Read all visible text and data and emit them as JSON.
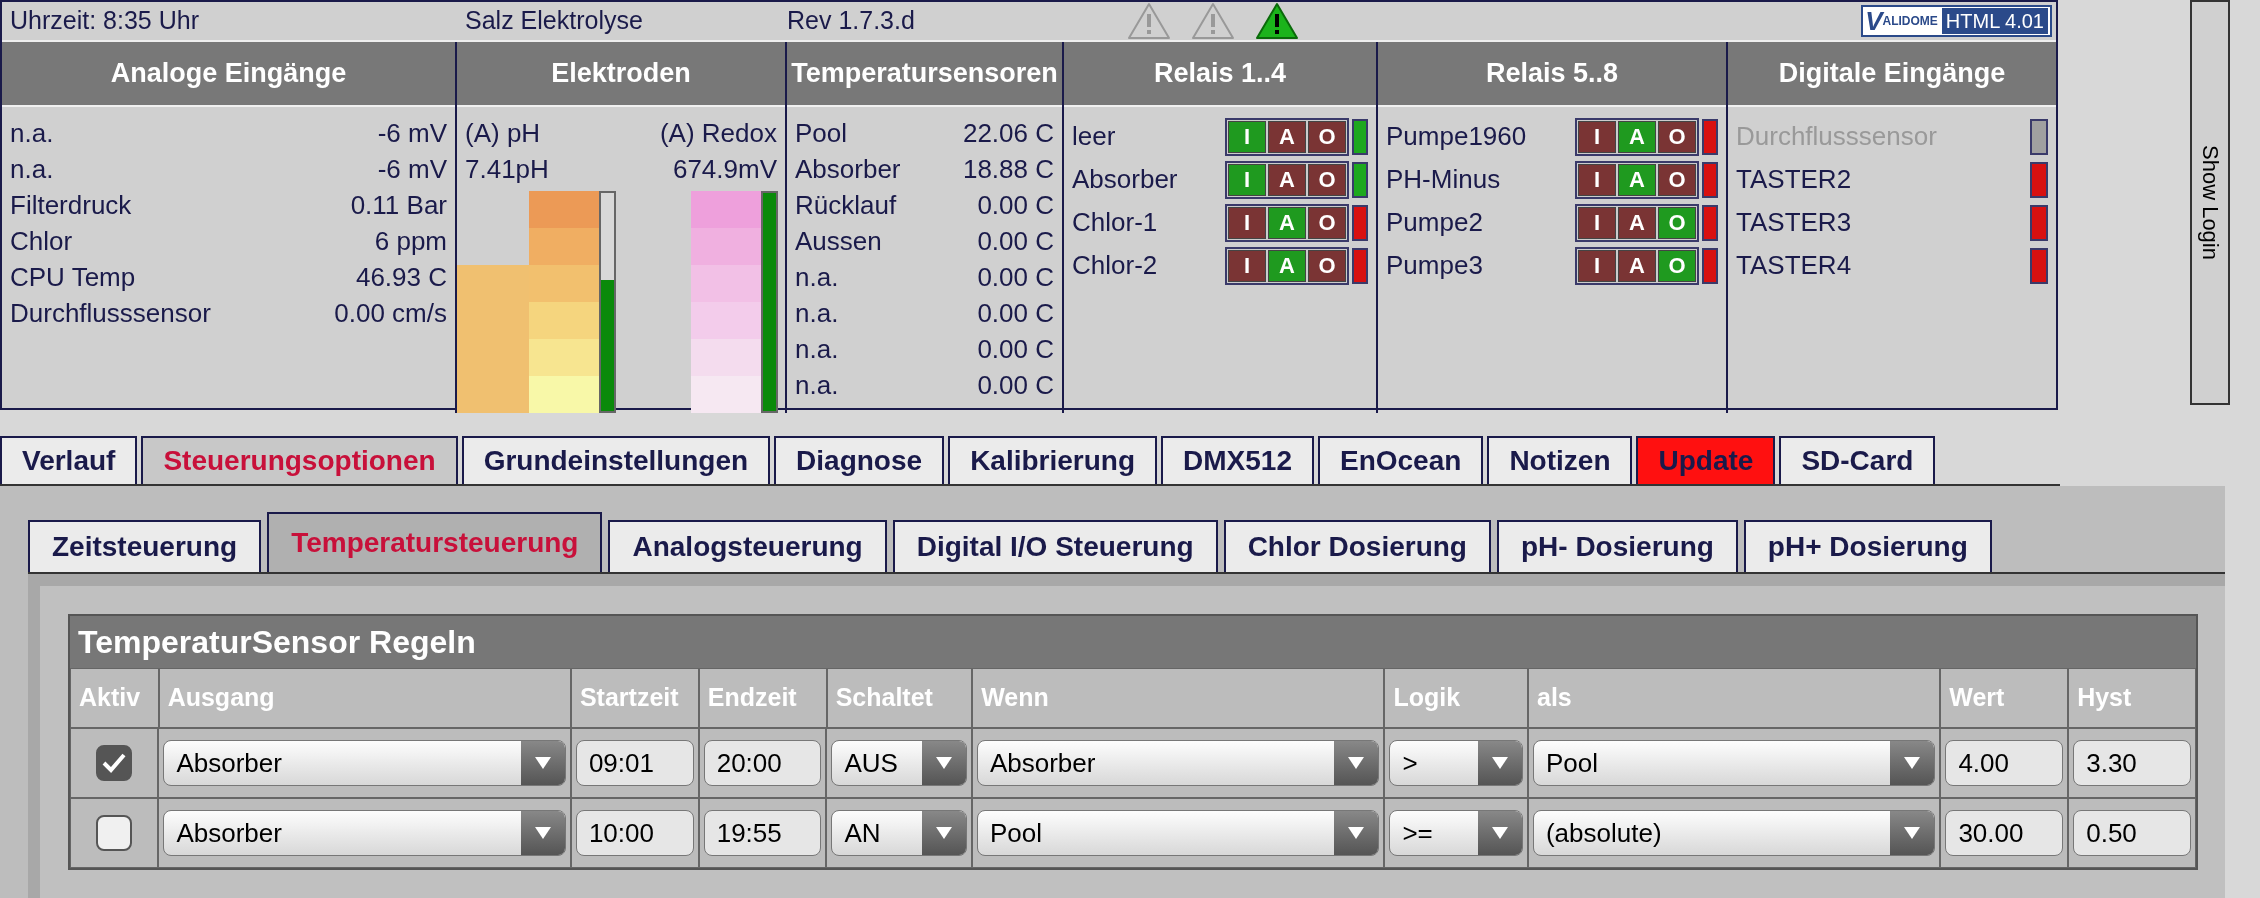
{
  "top_bar": {
    "time": "Uhrzeit: 8:35 Uhr",
    "title": "Salz Elektrolyse",
    "revision": "Rev 1.7.3.d",
    "warnings": [
      {
        "active": false
      },
      {
        "active": false
      },
      {
        "active": true
      }
    ],
    "badge": {
      "logo": "VALIDOME",
      "label": "HTML 4.01"
    }
  },
  "panels": {
    "analog": {
      "title": "Analoge Eingänge",
      "rows": [
        {
          "name": "n.a.",
          "value": "-6 mV"
        },
        {
          "name": "n.a.",
          "value": "-6 mV"
        },
        {
          "name": "Filterdruck",
          "value": "0.11 Bar"
        },
        {
          "name": "Chlor",
          "value": "6 ppm"
        },
        {
          "name": "CPU Temp",
          "value": "46.93 C"
        },
        {
          "name": "Durchflusssensor",
          "value": "0.00 cm/s"
        }
      ]
    },
    "electrodes": {
      "title": "Elektroden",
      "items": [
        {
          "kind": "ph",
          "name": "(A) pH",
          "value": "7.41pH",
          "level": 0.6
        },
        {
          "kind": "redox",
          "name": "(A) Redox",
          "value": "674.9mV",
          "level": 1.0
        }
      ]
    },
    "temperatures": {
      "title": "Temperatursensoren",
      "rows": [
        {
          "name": "Pool",
          "value": "22.06 C"
        },
        {
          "name": "Absorber",
          "value": "18.88 C"
        },
        {
          "name": "Rücklauf",
          "value": "0.00 C"
        },
        {
          "name": "Aussen",
          "value": "0.00 C"
        },
        {
          "name": "n.a.",
          "value": "0.00 C"
        },
        {
          "name": "n.a.",
          "value": "0.00 C"
        },
        {
          "name": "n.a.",
          "value": "0.00 C"
        },
        {
          "name": "n.a.",
          "value": "0.00 C"
        }
      ]
    },
    "relays": [
      {
        "title": "Relais 1..4",
        "rows": [
          {
            "name": "leer",
            "on": true,
            "modes": [
              {
                "label": "I",
                "selected": true
              },
              {
                "label": "A",
                "selected": false
              },
              {
                "label": "O",
                "selected": false
              }
            ]
          },
          {
            "name": "Absorber",
            "on": true,
            "modes": [
              {
                "label": "I",
                "selected": true
              },
              {
                "label": "A",
                "selected": false
              },
              {
                "label": "O",
                "selected": false
              }
            ]
          },
          {
            "name": "Chlor-1",
            "on": false,
            "modes": [
              {
                "label": "I",
                "selected": false
              },
              {
                "label": "A",
                "selected": true
              },
              {
                "label": "O",
                "selected": false
              }
            ]
          },
          {
            "name": "Chlor-2",
            "on": false,
            "modes": [
              {
                "label": "I",
                "selected": false
              },
              {
                "label": "A",
                "selected": true
              },
              {
                "label": "O",
                "selected": false
              }
            ]
          }
        ]
      },
      {
        "title": "Relais 5..8",
        "rows": [
          {
            "name": "Pumpe1960",
            "on": false,
            "modes": [
              {
                "label": "I",
                "selected": false
              },
              {
                "label": "A",
                "selected": true
              },
              {
                "label": "O",
                "selected": false
              }
            ]
          },
          {
            "name": "PH-Minus",
            "on": false,
            "modes": [
              {
                "label": "I",
                "selected": false
              },
              {
                "label": "A",
                "selected": true
              },
              {
                "label": "O",
                "selected": false
              }
            ]
          },
          {
            "name": "Pumpe2",
            "on": false,
            "modes": [
              {
                "label": "I",
                "selected": false
              },
              {
                "label": "A",
                "selected": false
              },
              {
                "label": "O",
                "selected": true
              }
            ]
          },
          {
            "name": "Pumpe3",
            "on": false,
            "modes": [
              {
                "label": "I",
                "selected": false
              },
              {
                "label": "A",
                "selected": false
              },
              {
                "label": "O",
                "selected": true
              }
            ]
          }
        ]
      }
    ],
    "digital": {
      "title": "Digitale Eingänge",
      "rows": [
        {
          "name": "Durchflusssensor",
          "disabled": true,
          "on": false
        },
        {
          "name": "TASTER2",
          "disabled": false,
          "on": false
        },
        {
          "name": "TASTER3",
          "disabled": false,
          "on": false
        },
        {
          "name": "TASTER4",
          "disabled": false,
          "on": false
        }
      ]
    }
  },
  "login_tab": {
    "label": "Show Login"
  },
  "tabs": [
    {
      "label": "Verlauf",
      "selected": false,
      "alert": false
    },
    {
      "label": "Steuerungsoptionen",
      "selected": true,
      "alert": false
    },
    {
      "label": "Grundeinstellungen",
      "selected": false,
      "alert": false
    },
    {
      "label": "Diagnose",
      "selected": false,
      "alert": false
    },
    {
      "label": "Kalibrierung",
      "selected": false,
      "alert": false
    },
    {
      "label": "DMX512",
      "selected": false,
      "alert": false
    },
    {
      "label": "EnOcean",
      "selected": false,
      "alert": false
    },
    {
      "label": "Notizen",
      "selected": false,
      "alert": false
    },
    {
      "label": "Update",
      "selected": false,
      "alert": true
    },
    {
      "label": "SD-Card",
      "selected": false,
      "alert": false
    }
  ],
  "subtabs": [
    {
      "label": "Zeitsteuerung",
      "selected": false
    },
    {
      "label": "Temperatursteuerung",
      "selected": true
    },
    {
      "label": "Analogsteuerung",
      "selected": false
    },
    {
      "label": "Digital I/O Steuerung",
      "selected": false
    },
    {
      "label": "Chlor Dosierung",
      "selected": false
    },
    {
      "label": "pH- Dosierung",
      "selected": false
    },
    {
      "label": "pH+ Dosierung",
      "selected": false
    }
  ],
  "table": {
    "title": "TemperaturSensor Regeln",
    "columns": [
      "Aktiv",
      "Ausgang",
      "Startzeit",
      "Endzeit",
      "Schaltet",
      "Wenn",
      "Logik",
      "als",
      "Wert",
      "Hyst"
    ],
    "rows": [
      {
        "checked": true,
        "ausgang": "Absorber",
        "startzeit": "09:01",
        "endzeit": "20:00",
        "schaltet": "AUS",
        "wenn": "Absorber",
        "logik": ">",
        "als": "Pool",
        "wert": "4.00",
        "hyst": "3.30"
      },
      {
        "checked": false,
        "ausgang": "Absorber",
        "startzeit": "10:00",
        "endzeit": "19:55",
        "schaltet": "AN",
        "wenn": "Pool",
        "logik": ">=",
        "als": "(absolute)",
        "wert": "30.00",
        "hyst": "0.50"
      }
    ]
  }
}
